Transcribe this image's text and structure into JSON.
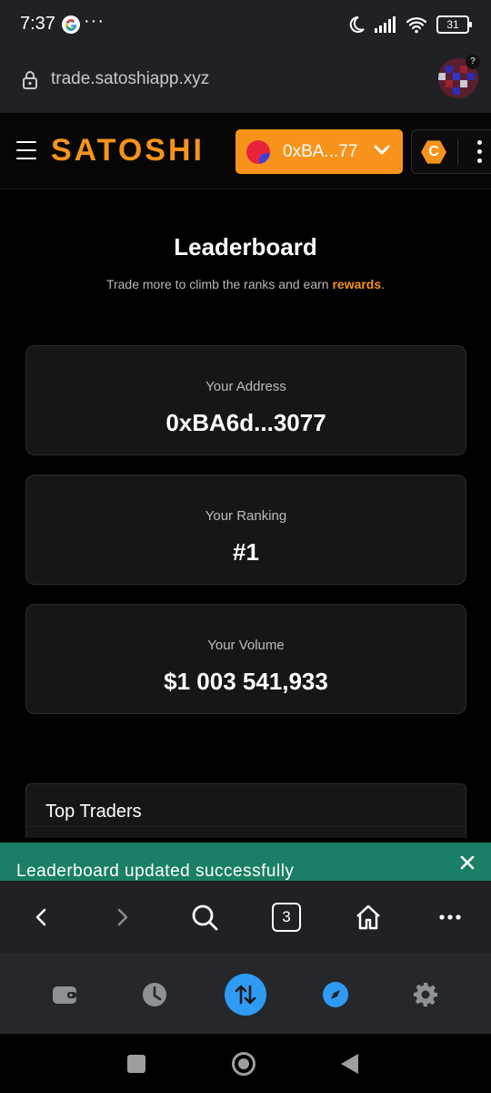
{
  "status_bar": {
    "time": "7:37",
    "notif_dots": "···",
    "battery": "31"
  },
  "browser": {
    "url": "trade.satoshiapp.xyz",
    "avatar_badge": "?",
    "tab_count": "3"
  },
  "header": {
    "logo": "SATOSHI",
    "wallet_address": "0xBA...77",
    "coin_letter": "C"
  },
  "main": {
    "title": "Leaderboard",
    "subtitle_prefix": "Trade more to climb the ranks and earn ",
    "subtitle_link": "rewards",
    "subtitle_suffix": ".",
    "cards": {
      "address_label": "Your Address",
      "address_value": "0xBA6d...3077",
      "ranking_label": "Your Ranking",
      "ranking_value": "#1",
      "volume_label": "Your Volume",
      "volume_value": "$1 003 541,933"
    },
    "top_traders_title": "Top Traders"
  },
  "toast": {
    "message": "Leaderboard updated successfully"
  },
  "colors": {
    "accent": "#f7931a",
    "toast": "#1a7f64",
    "active_nav": "#2f9bf5",
    "card_bg": "#161616"
  }
}
